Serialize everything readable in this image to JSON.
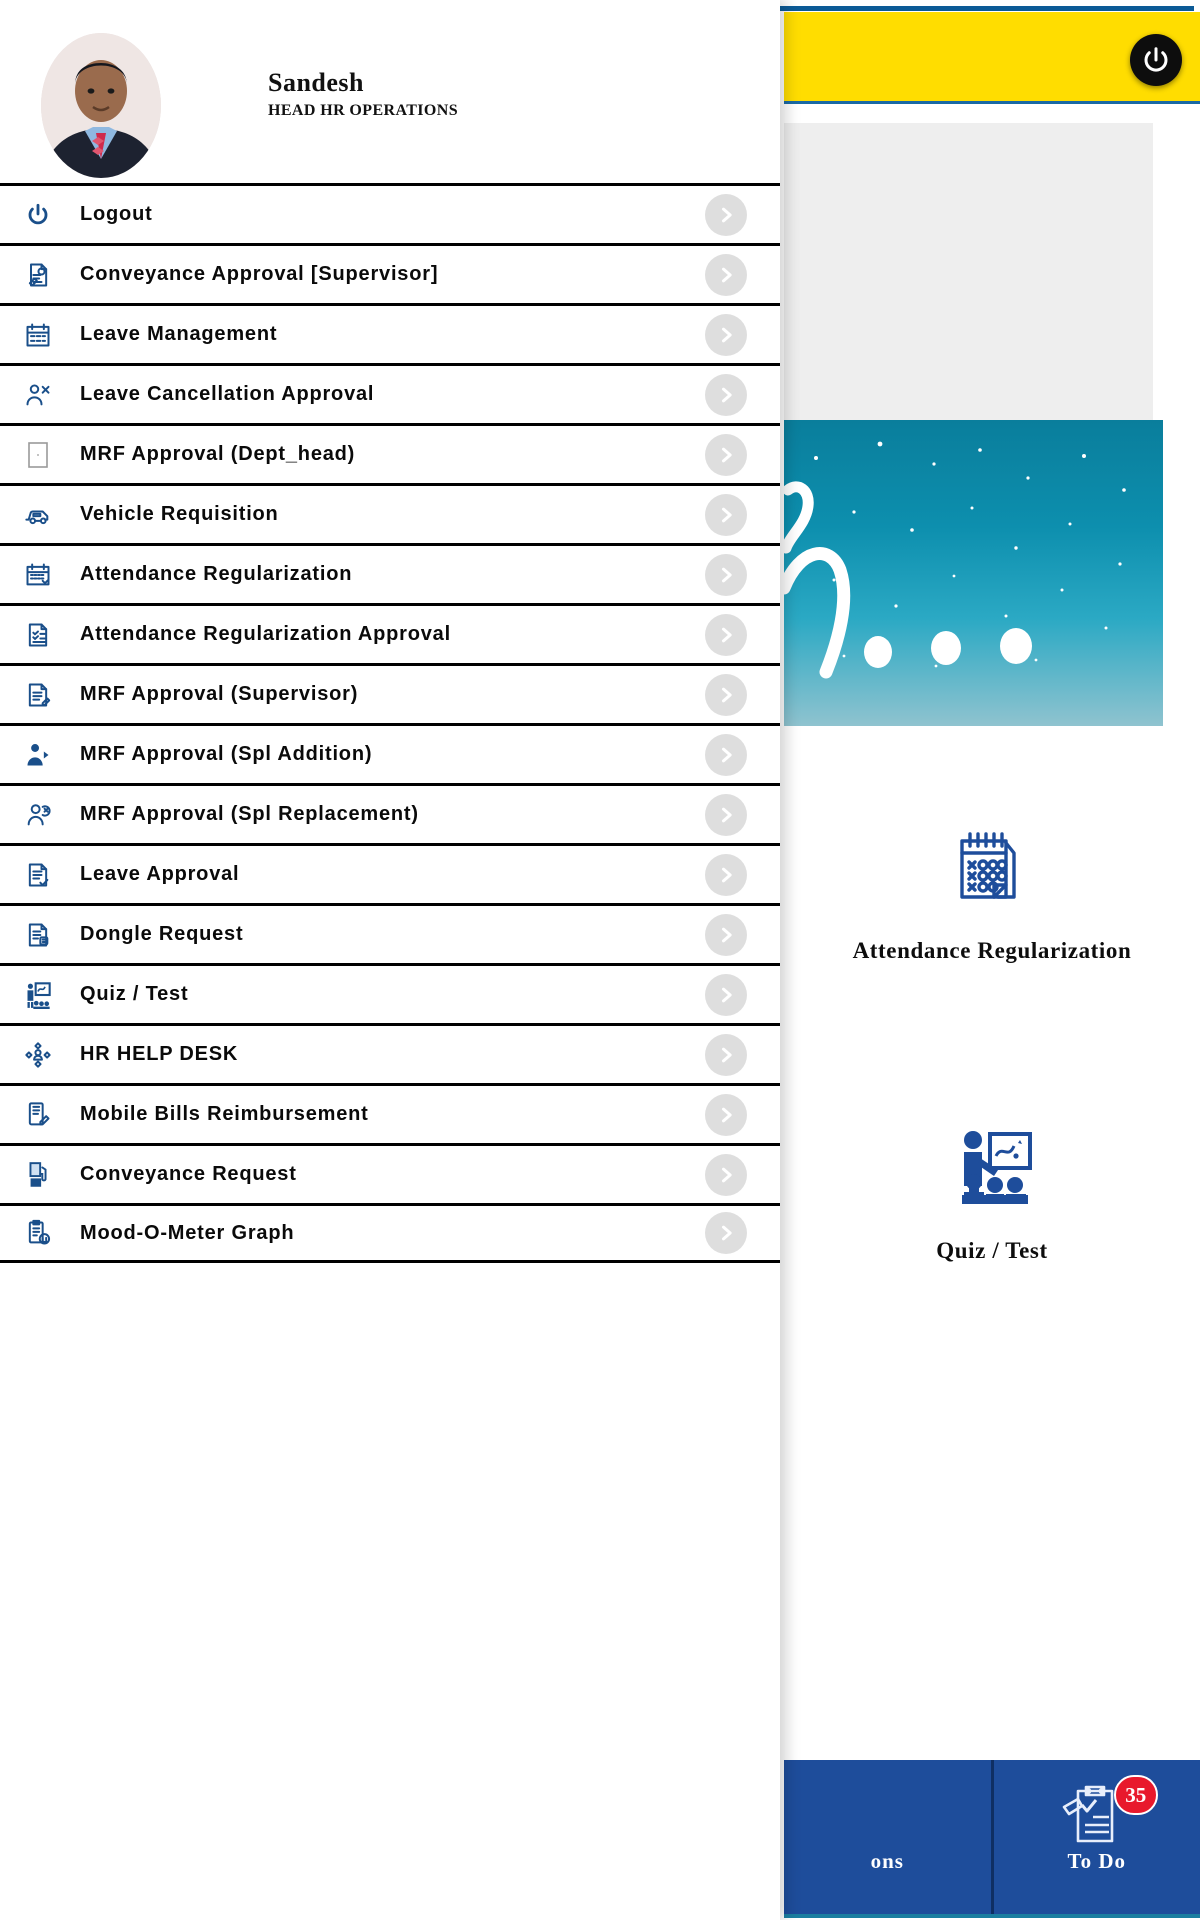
{
  "header": {
    "power_icon": "power-icon"
  },
  "profile": {
    "name": "Sandesh",
    "role": "HEAD HR OPERATIONS",
    "avatar_icon": "avatar"
  },
  "menu": {
    "items": [
      {
        "label": "Logout",
        "icon": "power-icon"
      },
      {
        "label": "Conveyance Approval [Supervisor]",
        "icon": "document-approval-icon"
      },
      {
        "label": "Leave Management",
        "icon": "calendar-grid-icon"
      },
      {
        "label": "Leave Cancellation Approval",
        "icon": "user-cancel-icon"
      },
      {
        "label": "MRF Approval (Dept_head)",
        "icon": "blank-page-icon"
      },
      {
        "label": "Vehicle Requisition",
        "icon": "vehicle-icon"
      },
      {
        "label": "Attendance Regularization",
        "icon": "calendar-icon"
      },
      {
        "label": "Attendance Regularization Approval",
        "icon": "checklist-page-icon"
      },
      {
        "label": "MRF Approval (Supervisor)",
        "icon": "document-pen-icon"
      },
      {
        "label": "MRF Approval (Spl Addition)",
        "icon": "user-add-icon"
      },
      {
        "label": "MRF Approval (Spl Replacement)",
        "icon": "user-replace-icon"
      },
      {
        "label": "Leave Approval",
        "icon": "document-check-icon"
      },
      {
        "label": "Dongle Request",
        "icon": "dongle-page-icon"
      },
      {
        "label": "Quiz / Test",
        "icon": "presenter-icon"
      },
      {
        "label": "HR HELP DESK",
        "icon": "help-desk-icon"
      },
      {
        "label": "Mobile Bills Reimbursement",
        "icon": "mobile-bill-icon"
      },
      {
        "label": "Conveyance Request",
        "icon": "fuel-pump-icon"
      },
      {
        "label": "Mood-O-Meter Graph",
        "icon": "mood-meter-icon"
      }
    ],
    "arrow_icon": "chevron-right-icon"
  },
  "tiles": [
    {
      "label": "Attendance Regularization",
      "icon": "attendance-calendar-icon"
    },
    {
      "label": "Quiz / Test",
      "icon": "classroom-presenter-icon"
    }
  ],
  "bottom_nav": {
    "items": [
      {
        "label": "ons",
        "icon": "applications-icon",
        "badge": ""
      },
      {
        "label": "To Do",
        "icon": "todo-clipboard-icon",
        "badge": "35"
      }
    ]
  },
  "colors": {
    "accent_blue": "#0b5a96",
    "header_yellow": "#ffdd00",
    "nav_blue": "#1e4d9b",
    "badge_red": "#e8192c",
    "icon_blue": "#1a4f8a"
  }
}
